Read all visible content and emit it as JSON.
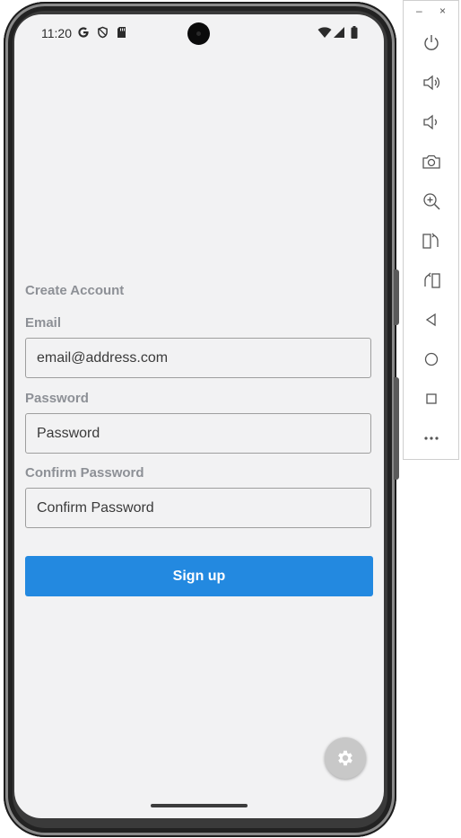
{
  "status_bar": {
    "time": "11:20",
    "icons": [
      "google-icon",
      "shield-icon",
      "sd-card-icon",
      "wifi-icon",
      "signal-icon",
      "battery-icon"
    ]
  },
  "form": {
    "title": "Create Account",
    "email_label": "Email",
    "email_value": "email@address.com",
    "password_label": "Password",
    "password_placeholder": "Password",
    "confirm_label": "Confirm Password",
    "confirm_placeholder": "Confirm Password",
    "signup_label": "Sign up"
  },
  "colors": {
    "accent": "#2389e0",
    "label": "#8d9096",
    "background": "#f2f2f3"
  },
  "emulator_panel": {
    "window_controls": [
      "minimize-icon",
      "close-icon"
    ],
    "tools": [
      "power-icon",
      "volume-up-icon",
      "volume-down-icon",
      "camera-icon",
      "zoom-icon",
      "rotate-left-icon",
      "rotate-right-icon",
      "back-icon",
      "home-icon",
      "overview-icon",
      "more-icon"
    ]
  }
}
